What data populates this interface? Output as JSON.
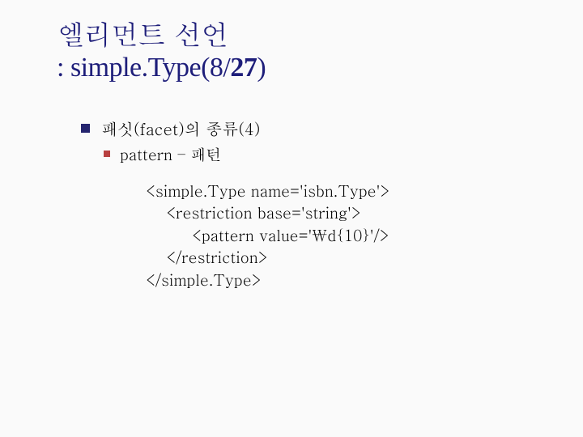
{
  "title": {
    "line1": "엘리먼트 선언",
    "line2_prefix": ": simple.Type(8/",
    "line2_bold": "27",
    "line2_suffix": ")"
  },
  "bullets": {
    "level1": "패싯(facet)의 종류(4)",
    "level2": "pattern – 패턴"
  },
  "code": {
    "l1": "<simple.Type name='isbn.Type'>",
    "l2": "    <restriction base='string'>",
    "l3": "         <pattern value='\\d{10}'/>",
    "l4": "    </restriction>",
    "l5": "</simple.Type>"
  }
}
